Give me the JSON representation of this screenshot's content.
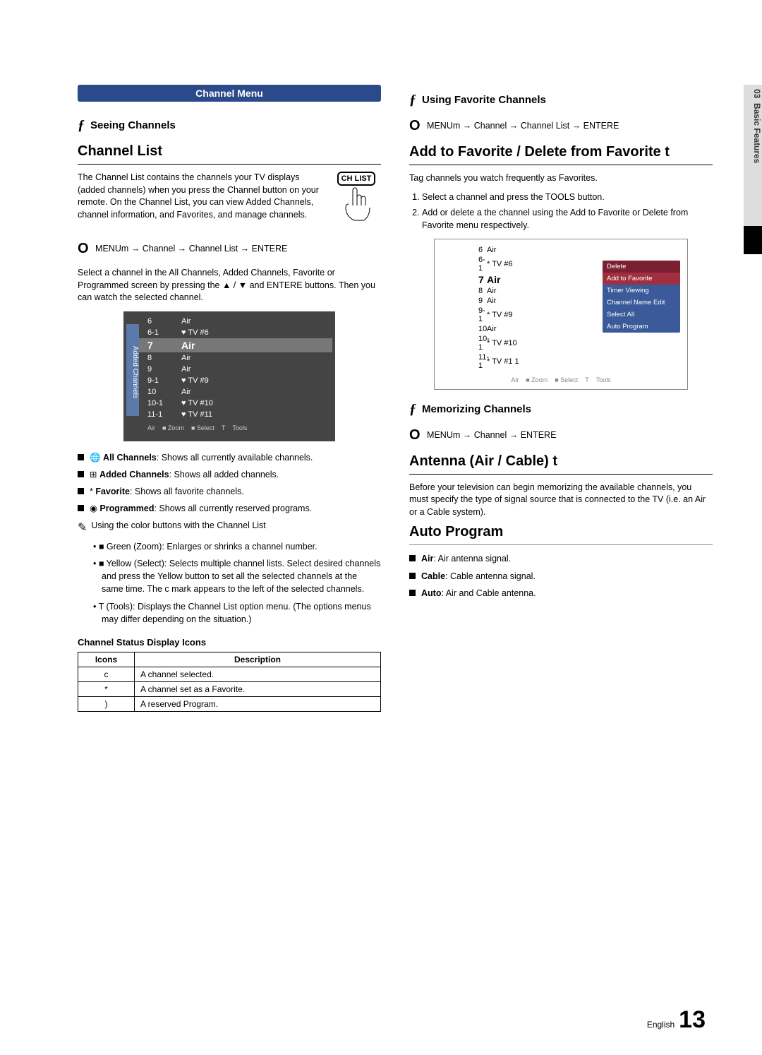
{
  "sidebar": {
    "chapter": "03",
    "section": "Basic Features"
  },
  "left": {
    "banner": "Channel Menu",
    "seeing": "Seeing Channels",
    "channelListTitle": "Channel List",
    "chlistIntro": "The Channel List contains the channels your TV displays (added channels) when you press the Channel button on your remote. On the Channel List, you can view Added Channels, channel information, and Favorites, and manage channels.",
    "remoteBtn": "CH LIST",
    "menuPath1": "MENUm  → Channel → Channel List → ENTERE",
    "selectText1": "Select a channel in the All Channels, Added Channels, Favorite or Programmed screen by pressing the ▲ / ▼ and ENTERE   buttons. Then you can watch the selected channel.",
    "tv": {
      "sideTab": "Added Channels",
      "rows": [
        {
          "num": "6",
          "name": "Air"
        },
        {
          "num": "6-1",
          "name": "♥ TV #6"
        },
        {
          "num": "7",
          "name": "Air",
          "hi": true
        },
        {
          "num": "8",
          "name": "Air"
        },
        {
          "num": "9",
          "name": "Air"
        },
        {
          "num": "9-1",
          "name": "♥ TV #9"
        },
        {
          "num": "10",
          "name": "Air"
        },
        {
          "num": "10-1",
          "name": "♥ TV #10"
        },
        {
          "num": "11-1",
          "name": "♥ TV #11"
        }
      ],
      "footer": [
        "Air",
        "■ Zoom",
        "■ Select",
        "T",
        "Tools"
      ]
    },
    "bulletList": [
      {
        "icon": "🌐",
        "strong": "All Channels",
        "text": ": Shows all currently available channels."
      },
      {
        "icon": "⊞",
        "strong": "Added Channels",
        "text": ": Shows all added channels."
      },
      {
        "icon": "*",
        "strong": "Favorite",
        "text": ": Shows all favorite channels."
      },
      {
        "icon": "◉",
        "strong": "Programmed",
        "text": ": Shows all currently reserved programs."
      }
    ],
    "noteIntro": "Using the color buttons with the Channel List",
    "subBullets": [
      "■ Green (Zoom): Enlarges or shrinks a channel number.",
      "■ Yellow (Select): Selects multiple channel lists. Select desired channels and press the Yellow button to set all the selected channels at the same time. The c   mark appears to the left of the selected channels.",
      "T   (Tools): Displays the Channel List option menu. (The options menus may differ depending on the situation.)"
    ],
    "iconsTableTitle": "Channel Status Display Icons",
    "iconsTable": {
      "headers": [
        "Icons",
        "Description"
      ],
      "rows": [
        [
          "c",
          "A channel selected."
        ],
        [
          "*",
          "A channel set as a Favorite."
        ],
        [
          ")",
          "A reserved Program."
        ]
      ]
    }
  },
  "right": {
    "usingFav": "Using Favorite Channels",
    "menuPath2": "MENUm  → Channel → Channel List → ENTERE",
    "addDelTitle": "Add to Favorite / Delete from Favorite t",
    "tagIntro": "Tag channels you watch frequently as Favorites.",
    "steps": [
      "Select a channel and press the TOOLS button.",
      "Add or delete a the channel using the Add to Favorite or Delete from Favorite menu respectively."
    ],
    "favTv": {
      "rows": [
        {
          "num": "6",
          "name": "Air"
        },
        {
          "num": "6-1",
          "name": "* TV #6"
        },
        {
          "num": "7",
          "name": "Air",
          "hi": true
        },
        {
          "num": "8",
          "name": "Air"
        },
        {
          "num": "9",
          "name": "Air"
        },
        {
          "num": "9-1",
          "name": "* TV #9"
        },
        {
          "num": "10",
          "name": "Air"
        },
        {
          "num": "10-1",
          "name": "* TV #10"
        },
        {
          "num": "11-1",
          "name": "* TV #1  1"
        }
      ],
      "popup": [
        "Delete",
        "Add to Favorite",
        "Timer Viewing",
        "Channel Name Edit",
        "Select All",
        "Auto Program"
      ],
      "foot": [
        "Air",
        "■ Zoom",
        "■ Select",
        "T",
        "Tools"
      ]
    },
    "memorizing": "Memorizing Channels",
    "menuPath3": "MENUm  → Channel → ENTERE",
    "antennaTitle": "Antenna (Air / Cable) t",
    "antennaText": "Before your television can begin memorizing the available channels, you must specify the type of signal source that is connected to the TV (i.e. an Air or a Cable system).",
    "autoProgTitle": "Auto Program",
    "autoProgBullets": [
      {
        "strong": "Air",
        "text": ": Air antenna signal."
      },
      {
        "strong": "Cable",
        "text": ": Cable antenna signal."
      },
      {
        "strong": "Auto",
        "text": ": Air and Cable antenna."
      }
    ]
  },
  "footer": {
    "lang": "English",
    "page": "13"
  }
}
